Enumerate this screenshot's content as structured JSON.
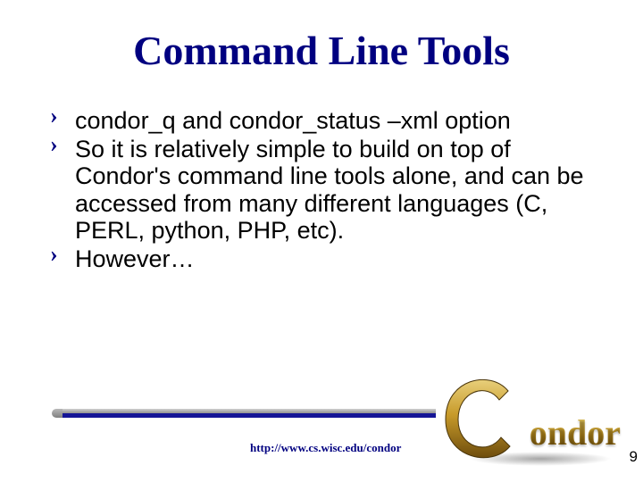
{
  "title": "Command Line Tools",
  "bullets": [
    "condor_q and condor_status –xml option",
    "So it is relatively simple to build on top of Condor's command line tools alone, and can be accessed from many different languages (C, PERL, python, PHP, etc).",
    "However…"
  ],
  "bullet_marker": "›",
  "footer_url": "http://www.cs.wisc.edu/condor",
  "page_number": "9",
  "logo_text": "ondor",
  "logo_full_name": "Condor"
}
